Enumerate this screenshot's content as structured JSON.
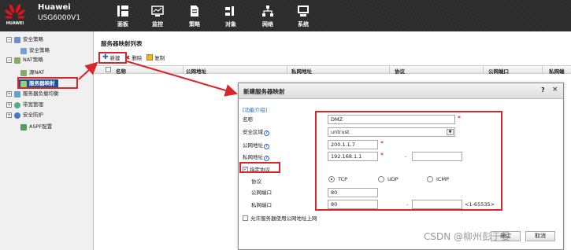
{
  "brand": {
    "logo_text": "HUAWEI",
    "name": "Huawei",
    "model": "USG6000V1",
    "logo_color": "#e0141e"
  },
  "nav": [
    {
      "label": "面板",
      "icon": "dashboard-icon"
    },
    {
      "label": "监控",
      "icon": "monitor-icon"
    },
    {
      "label": "策略",
      "icon": "policy-icon"
    },
    {
      "label": "对象",
      "icon": "object-icon"
    },
    {
      "label": "网络",
      "icon": "network-icon"
    },
    {
      "label": "系统",
      "icon": "system-icon"
    }
  ],
  "sidebar": {
    "items": [
      {
        "label": "安全策略",
        "toggle": "⊟",
        "icon": "security-policy-icon"
      },
      {
        "label": "安全策略",
        "toggle": "",
        "icon": "security-policy-leaf-icon"
      },
      {
        "label": "NAT策略",
        "toggle": "⊟",
        "icon": "nat-policy-icon"
      },
      {
        "label": "源NAT",
        "toggle": "",
        "icon": "source-nat-icon"
      },
      {
        "label": "服务器映射",
        "toggle": "",
        "icon": "server-mapping-icon",
        "selected": true
      },
      {
        "label": "服务器负载均衡",
        "toggle": "⊞",
        "icon": "load-balance-icon"
      },
      {
        "label": "带宽管理",
        "toggle": "⊞",
        "icon": "bandwidth-icon"
      },
      {
        "label": "安全防护",
        "toggle": "⊞",
        "icon": "protection-icon"
      },
      {
        "label": "ASPF配置",
        "toggle": "",
        "icon": "aspf-icon"
      }
    ]
  },
  "main": {
    "list_title": "服务器映射列表",
    "toolbar": {
      "new": "新建",
      "delete": "删除",
      "copy": "复制"
    },
    "columns": [
      "名称",
      "公网地址",
      "私网地址",
      "协议",
      "公网端口",
      "私网端"
    ]
  },
  "dialog": {
    "title": "新建服务器映射",
    "help": "?",
    "close": "×",
    "intro_link": "[功能介绍]",
    "labels": {
      "name": "名称",
      "zone": "安全区域",
      "public_ip": "公网地址",
      "private_ip": "私网地址",
      "specify_protocol": "指定协议",
      "protocol": "协议",
      "public_port": "公网端口",
      "private_port": "私网端口",
      "allow_public": "允许服务器使用公网地址上网"
    },
    "values": {
      "name": "DMZ",
      "zone": "untrust",
      "public_ip": "200.1.1.7",
      "private_ip": "192.168.1.1",
      "public_port": "80",
      "private_port": "80"
    },
    "protocols": [
      {
        "label": "TCP",
        "selected": true
      },
      {
        "label": "UDP",
        "selected": false
      },
      {
        "label": "ICMP",
        "selected": false
      }
    ],
    "port_range": "<1-65535>",
    "specify_protocol_checked": "✓",
    "allow_public_checked": "",
    "required_mark": "*",
    "range_dash": "-",
    "footer": {
      "ok": "确定",
      "cancel": "取消"
    }
  },
  "annotation_color": "#d8262c",
  "watermark": "CSDN @柳州彭于晏"
}
